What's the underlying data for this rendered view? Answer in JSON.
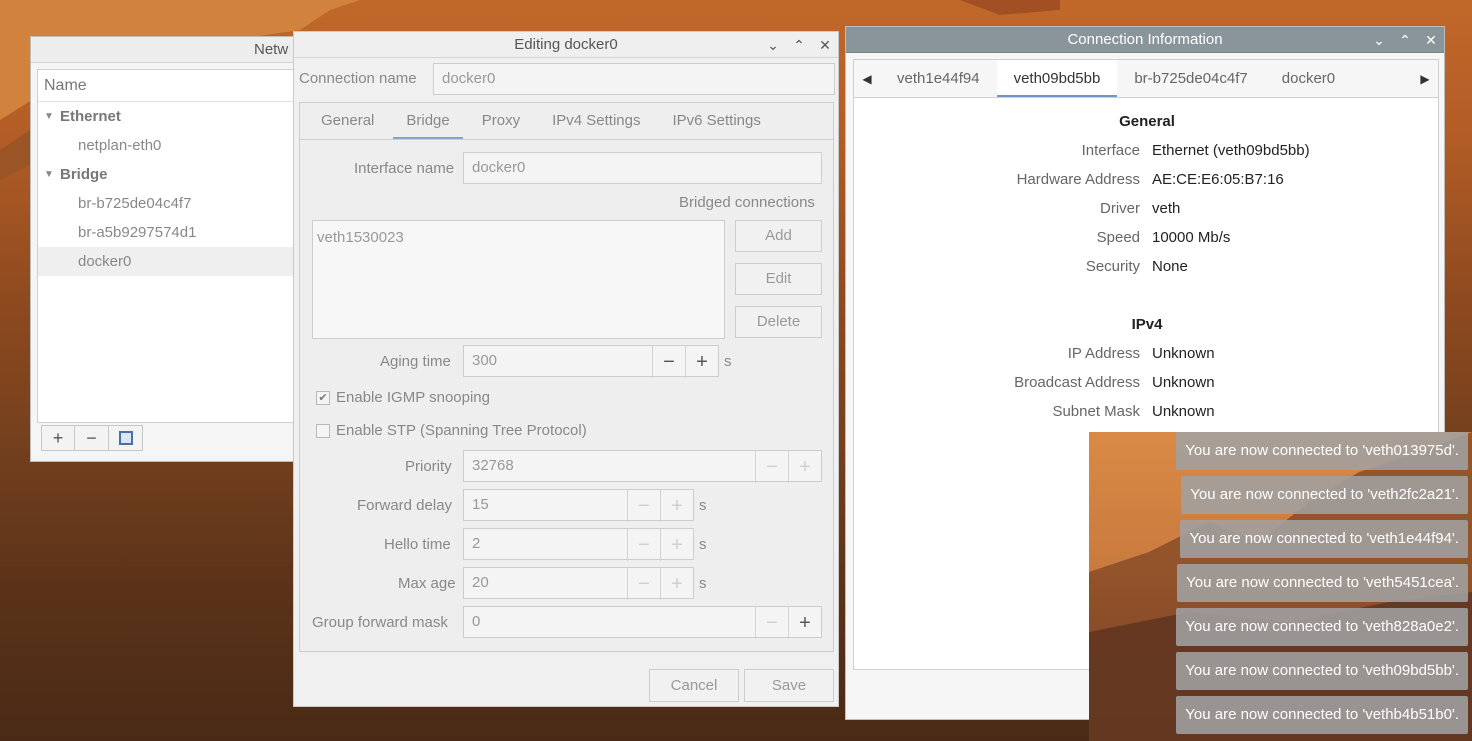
{
  "net_window": {
    "title": "Netw",
    "column_header": "Name",
    "groups": [
      {
        "name": "Ethernet",
        "items": [
          "netplan-eth0"
        ]
      },
      {
        "name": "Bridge",
        "items": [
          "br-b725de04c4f7",
          "br-a5b9297574d1",
          "docker0"
        ]
      }
    ],
    "toolbar": {
      "add_icon": "plus-icon",
      "remove_icon": "minus-icon",
      "settings_icon": "settings-icon"
    }
  },
  "edit_window": {
    "title": "Editing docker0",
    "connection_name_label": "Connection name",
    "connection_name_value": "docker0",
    "tabs": [
      "General",
      "Bridge",
      "Proxy",
      "IPv4 Settings",
      "IPv6 Settings"
    ],
    "active_tab": "Bridge",
    "interface_name_label": "Interface name",
    "interface_name_value": "docker0",
    "bridged_connections_label": "Bridged connections",
    "bridged_connections": [
      "veth1530023"
    ],
    "buttons": {
      "add": "Add",
      "edit": "Edit",
      "delete": "Delete"
    },
    "aging_time_label": "Aging time",
    "aging_time_value": "300",
    "aging_time_unit": "s",
    "igmp_label": "Enable IGMP snooping",
    "igmp_checked": true,
    "stp_label": "Enable STP (Spanning Tree Protocol)",
    "stp_checked": false,
    "priority_label": "Priority",
    "priority_value": "32768",
    "forward_delay_label": "Forward delay",
    "forward_delay_value": "15",
    "forward_delay_unit": "s",
    "hello_time_label": "Hello time",
    "hello_time_value": "2",
    "hello_time_unit": "s",
    "max_age_label": "Max age",
    "max_age_value": "20",
    "max_age_unit": "s",
    "group_forward_mask_label": "Group forward mask",
    "group_forward_mask_value": "0",
    "cancel": "Cancel",
    "save": "Save"
  },
  "info_window": {
    "title": "Connection Information",
    "tabs": [
      "veth1e44f94",
      "veth09bd5bb",
      "br-b725de04c4f7",
      "docker0"
    ],
    "active_tab": "veth09bd5bb",
    "general_title": "General",
    "general": [
      {
        "label": "Interface",
        "value": "Ethernet (veth09bd5bb)"
      },
      {
        "label": "Hardware Address",
        "value": "AE:CE:E6:05:B7:16"
      },
      {
        "label": "Driver",
        "value": "veth"
      },
      {
        "label": "Speed",
        "value": "10000 Mb/s"
      },
      {
        "label": "Security",
        "value": "None"
      }
    ],
    "ipv4_title": "IPv4",
    "ipv4": [
      {
        "label": "IP Address",
        "value": "Unknown"
      },
      {
        "label": "Broadcast Address",
        "value": "Unknown"
      },
      {
        "label": "Subnet Mask",
        "value": "Unknown"
      }
    ]
  },
  "notifications": [
    "You are now connected to 'veth013975d'.",
    "You are now connected to 'veth2fc2a21'.",
    "You are now connected to 'veth1e44f94'.",
    "You are now connected to 'veth5451cea'.",
    "You are now connected to 'veth828a0e2'.",
    "You are now connected to 'veth09bd5bb'.",
    "You are now connected to 'vethb4b51b0'."
  ]
}
